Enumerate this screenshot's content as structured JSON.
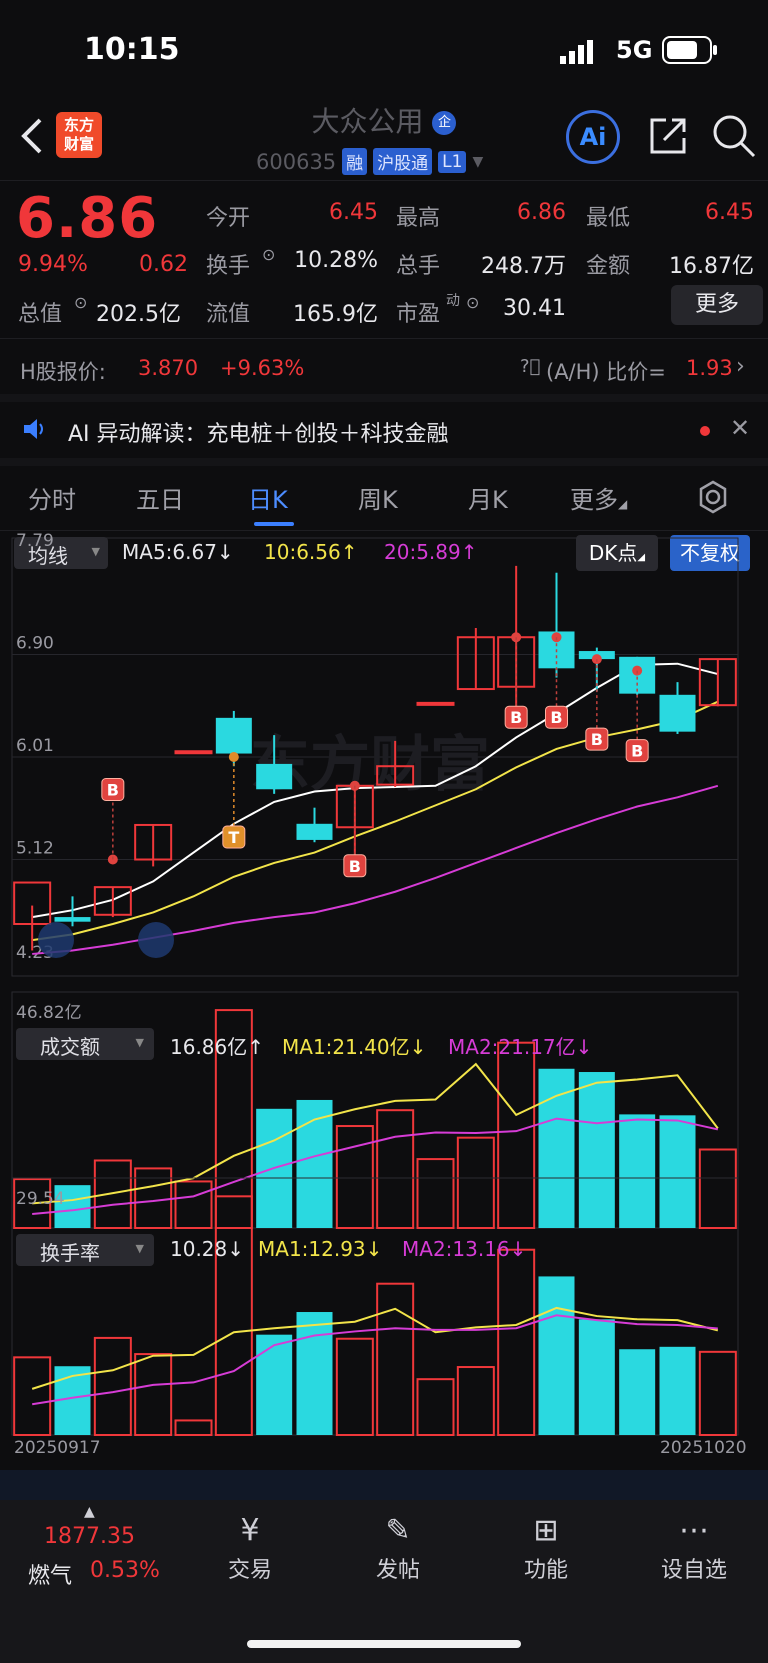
{
  "status": {
    "time": "10:15",
    "network": "5G"
  },
  "header": {
    "logo_text": "东方财富",
    "stock_name": "大众公用",
    "name_badge": "企",
    "code": "600635",
    "tags": [
      "融",
      "沪股通",
      "L1"
    ],
    "ai_label": "Ai"
  },
  "quote": {
    "price": "6.86",
    "change_pct": "9.94%",
    "change": "0.62",
    "total_value_label": "总值",
    "total_value": "202.5亿",
    "open_label": "今开",
    "open": "6.45",
    "turnover_label": "换手",
    "turnover": "10.28%",
    "float_label": "流值",
    "float_value": "165.9亿",
    "high_label": "最高",
    "high": "6.86",
    "volume_label": "总手",
    "volume": "248.7万",
    "pe_label": "市盈",
    "pe_sup": "动",
    "pe": "30.41",
    "low_label": "最低",
    "low": "6.45",
    "amount_label": "金额",
    "amount": "16.87亿",
    "more_label": "更多"
  },
  "hshare": {
    "label": "H股报价:",
    "price": "3.870",
    "change": "+9.63%",
    "ratio_label": "(A/H) 比价=",
    "ratio": "1.93"
  },
  "ai_banner": {
    "text": "AI 异动解读：充电桩＋创投＋科技金融"
  },
  "tabs": [
    "分时",
    "五日",
    "日K",
    "周K",
    "月K",
    "更多"
  ],
  "chart_controls": {
    "indicator": "均线",
    "ma5": "MA5:6.67↓",
    "ma10": "10:6.56↑",
    "ma20": "20:5.89↑",
    "dk_label": "DK点",
    "adjust_label": "不复权",
    "vol_indicator": "成交额",
    "vol_value": "16.86亿↑",
    "vol_ma1": "MA1:21.40亿↓",
    "vol_ma2": "MA2:21.17亿↓",
    "turn_indicator": "换手率",
    "turn_value": "10.28↓",
    "turn_ma1": "MA1:12.93↓",
    "turn_ma2": "MA2:13.16↓",
    "date_start": "20250917",
    "date_end": "20251020",
    "watermark": "东方财富",
    "signal_b": "B",
    "signal_t": "T"
  },
  "colors": {
    "up": "#f0373a",
    "down": "#2ad9e0",
    "ma5": "#ffffff",
    "ma10": "#f2e44a",
    "ma20": "#d63cd6",
    "accent": "#3b7fff"
  },
  "chart_data": [
    {
      "type": "candlestick",
      "title": "日K",
      "yticks": [
        "7.79",
        "6.90",
        "6.01",
        "5.12",
        "4.23"
      ],
      "ylim": [
        4.23,
        7.79
      ],
      "candles": [
        {
          "o": 4.56,
          "h": 4.72,
          "l": 4.33,
          "c": 4.92
        },
        {
          "o": 4.62,
          "h": 4.8,
          "l": 4.54,
          "c": 4.58
        },
        {
          "o": 4.64,
          "h": 4.88,
          "l": 4.62,
          "c": 4.88
        },
        {
          "o": 5.12,
          "h": 5.42,
          "l": 5.06,
          "c": 5.42
        },
        {
          "o": 6.06,
          "h": 6.06,
          "l": 6.06,
          "c": 6.06
        },
        {
          "o": 6.35,
          "h": 6.41,
          "l": 5.93,
          "c": 6.04
        },
        {
          "o": 5.95,
          "h": 6.2,
          "l": 5.69,
          "c": 5.73
        },
        {
          "o": 5.43,
          "h": 5.57,
          "l": 5.27,
          "c": 5.29
        },
        {
          "o": 5.4,
          "h": 5.78,
          "l": 5.03,
          "c": 5.76
        },
        {
          "o": 5.77,
          "h": 6.15,
          "l": 5.75,
          "c": 5.93
        },
        {
          "o": 6.48,
          "h": 6.48,
          "l": 6.48,
          "c": 6.48
        },
        {
          "o": 6.6,
          "h": 7.13,
          "l": 6.6,
          "c": 7.05
        },
        {
          "o": 6.62,
          "h": 7.67,
          "l": 6.44,
          "c": 7.05
        },
        {
          "o": 7.1,
          "h": 7.61,
          "l": 6.7,
          "c": 6.78
        },
        {
          "o": 6.93,
          "h": 6.96,
          "l": 6.58,
          "c": 6.86
        },
        {
          "o": 6.88,
          "h": 6.88,
          "l": 6.55,
          "c": 6.56
        },
        {
          "o": 6.55,
          "h": 6.66,
          "l": 6.21,
          "c": 6.23
        },
        {
          "o": 6.46,
          "h": 6.86,
          "l": 6.45,
          "c": 6.86
        }
      ],
      "ma5": [
        4.62,
        4.68,
        4.77,
        4.93,
        5.18,
        5.43,
        5.62,
        5.71,
        5.74,
        5.75,
        5.76,
        5.93,
        6.18,
        6.39,
        6.61,
        6.81,
        6.82,
        6.73
      ],
      "ma10": [
        4.42,
        4.47,
        4.56,
        4.66,
        4.8,
        4.97,
        5.09,
        5.18,
        5.32,
        5.45,
        5.59,
        5.73,
        5.92,
        6.08,
        6.18,
        6.25,
        6.33,
        6.49
      ],
      "ma20": [
        4.3,
        4.33,
        4.38,
        4.44,
        4.5,
        4.57,
        4.62,
        4.66,
        4.74,
        4.84,
        4.96,
        5.09,
        5.22,
        5.35,
        5.47,
        5.58,
        5.66,
        5.76
      ],
      "signals": [
        {
          "index": 2,
          "label": "B",
          "price": 5.12
        },
        {
          "index": 5,
          "label": "T",
          "price": 6.01
        },
        {
          "index": 8,
          "label": "B",
          "price": 5.76
        },
        {
          "index": 12,
          "label": "B",
          "price": 7.05
        },
        {
          "index": 13,
          "label": "B",
          "price": 7.05
        },
        {
          "index": 14,
          "label": "B",
          "price": 6.86
        },
        {
          "index": 15,
          "label": "B",
          "price": 6.76
        }
      ]
    },
    {
      "type": "bar",
      "title": "成交额",
      "ymax_label": "46.82亿",
      "ylim": [
        0,
        46.82
      ],
      "unit": "亿",
      "values": [
        10.5,
        9.2,
        14.5,
        12.8,
        10.0,
        46.8,
        25.6,
        27.5,
        21.9,
        25.3,
        14.8,
        19.4,
        39.8,
        34.2,
        33.5,
        24.4,
        24.2,
        16.86
      ],
      "up": [
        true,
        false,
        true,
        true,
        true,
        true,
        false,
        false,
        true,
        true,
        true,
        true,
        true,
        false,
        false,
        false,
        false,
        true
      ],
      "ma1": [
        5.3,
        6.0,
        7.5,
        9.0,
        10.7,
        15.5,
        18.8,
        23.3,
        25.5,
        27.3,
        27.6,
        35.2,
        24.3,
        28.4,
        31.2,
        31.9,
        32.8,
        21.4
      ],
      "ma2": [
        3.0,
        3.8,
        5.0,
        5.8,
        6.8,
        9.9,
        12.9,
        15.4,
        17.5,
        19.6,
        20.5,
        20.4,
        20.8,
        23.5,
        22.5,
        23.3,
        23.1,
        21.17
      ]
    },
    {
      "type": "bar",
      "title": "换手率",
      "ymax_label": "29.54",
      "ylim": [
        0,
        29.54
      ],
      "values": [
        9.6,
        8.5,
        12.0,
        10.0,
        1.8,
        29.5,
        12.4,
        15.2,
        11.9,
        18.7,
        6.9,
        8.4,
        22.9,
        19.6,
        14.3,
        10.6,
        10.9,
        10.28
      ],
      "up": [
        true,
        false,
        true,
        true,
        true,
        true,
        false,
        false,
        true,
        true,
        true,
        true,
        true,
        false,
        false,
        false,
        false,
        true
      ],
      "ma1": [
        5.7,
        7.3,
        8.0,
        9.8,
        9.9,
        12.7,
        13.2,
        13.6,
        14.0,
        15.6,
        12.7,
        13.3,
        13.6,
        15.7,
        14.7,
        14.3,
        14.2,
        12.93
      ],
      "ma2": [
        3.8,
        4.6,
        5.3,
        6.2,
        6.5,
        7.9,
        11.1,
        12.3,
        12.8,
        13.2,
        13.0,
        13.0,
        13.2,
        14.8,
        14.2,
        13.7,
        13.6,
        13.16
      ]
    }
  ],
  "bottom": {
    "index_value": "1877.35",
    "index_name": "燃气",
    "index_change": "0.53%",
    "nav": [
      "交易",
      "发帖",
      "功能",
      "设自选"
    ]
  }
}
